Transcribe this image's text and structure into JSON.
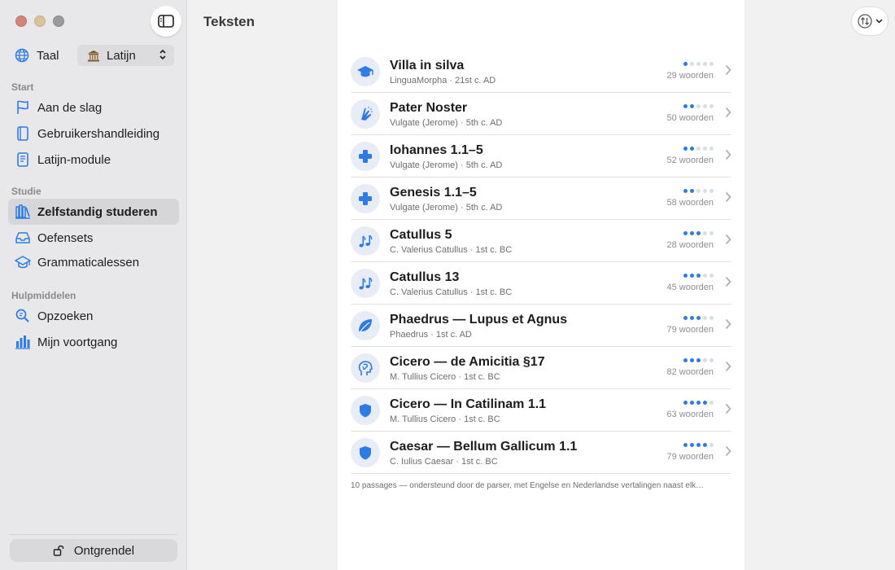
{
  "sidebar": {
    "language_label": "Taal",
    "language_value": "Latijn",
    "sections": [
      {
        "heading": "Start",
        "items": [
          {
            "label": "Aan de slag",
            "icon": "flag-icon"
          },
          {
            "label": "Gebruikershandleiding",
            "icon": "book-icon"
          },
          {
            "label": "Latijn-module",
            "icon": "document-icon"
          }
        ]
      },
      {
        "heading": "Studie",
        "items": [
          {
            "label": "Zelfstandig studeren",
            "icon": "books-icon",
            "active": true
          },
          {
            "label": "Oefensets",
            "icon": "tray-icon"
          },
          {
            "label": "Grammaticalessen",
            "icon": "graduation-cap-icon"
          }
        ]
      },
      {
        "heading": "Hulpmiddelen",
        "items": [
          {
            "label": "Opzoeken",
            "icon": "search-icon"
          },
          {
            "label": "Mijn voortgang",
            "icon": "bar-chart-icon"
          }
        ]
      }
    ],
    "unlock_label": "Ontgrendel"
  },
  "main": {
    "title": "Teksten",
    "texts": [
      {
        "title": "Villa in silva",
        "meta": "LinguaMorpha · 21st c. AD",
        "count": "29 woorden",
        "level": 1,
        "icon": "graduation-cap-icon"
      },
      {
        "title": "Pater Noster",
        "meta": "Vulgate (Jerome) · 5th c. AD",
        "count": "50 woorden",
        "level": 2,
        "icon": "praying-hands-icon"
      },
      {
        "title": "Iohannes 1.1–5",
        "meta": "Vulgate (Jerome) · 5th c. AD",
        "count": "52 woorden",
        "level": 2,
        "icon": "cross-icon"
      },
      {
        "title": "Genesis 1.1–5",
        "meta": "Vulgate (Jerome) · 5th c. AD",
        "count": "58 woorden",
        "level": 2,
        "icon": "cross-icon"
      },
      {
        "title": "Catullus 5",
        "meta": "C. Valerius Catullus · 1st c. BC",
        "count": "28 woorden",
        "level": 3,
        "icon": "music-notes-icon"
      },
      {
        "title": "Catullus 13",
        "meta": "C. Valerius Catullus · 1st c. BC",
        "count": "45 woorden",
        "level": 3,
        "icon": "music-notes-icon"
      },
      {
        "title": "Phaedrus — Lupus et Agnus",
        "meta": "Phaedrus · 1st c. AD",
        "count": "79 woorden",
        "level": 3,
        "icon": "leaf-icon"
      },
      {
        "title": "Cicero — de Amicitia §17",
        "meta": "M. Tullius Cicero · 1st c. BC",
        "count": "82 woorden",
        "level": 3,
        "icon": "head-icon"
      },
      {
        "title": "Cicero — In Catilinam 1.1",
        "meta": "M. Tullius Cicero · 1st c. BC",
        "count": "63 woorden",
        "level": 4,
        "icon": "shield-icon"
      },
      {
        "title": "Caesar — Bellum Gallicum 1.1",
        "meta": "C. Iulius Caesar · 1st c. BC",
        "count": "79 woorden",
        "level": 4,
        "icon": "shield-icon"
      }
    ],
    "footer": "10 passages — ondersteund door de parser, met Engelse en Nederlandse vertalingen naast elk…"
  },
  "colors": {
    "accent": "#2f7be5",
    "icon_bg": "#e7ecf6"
  }
}
